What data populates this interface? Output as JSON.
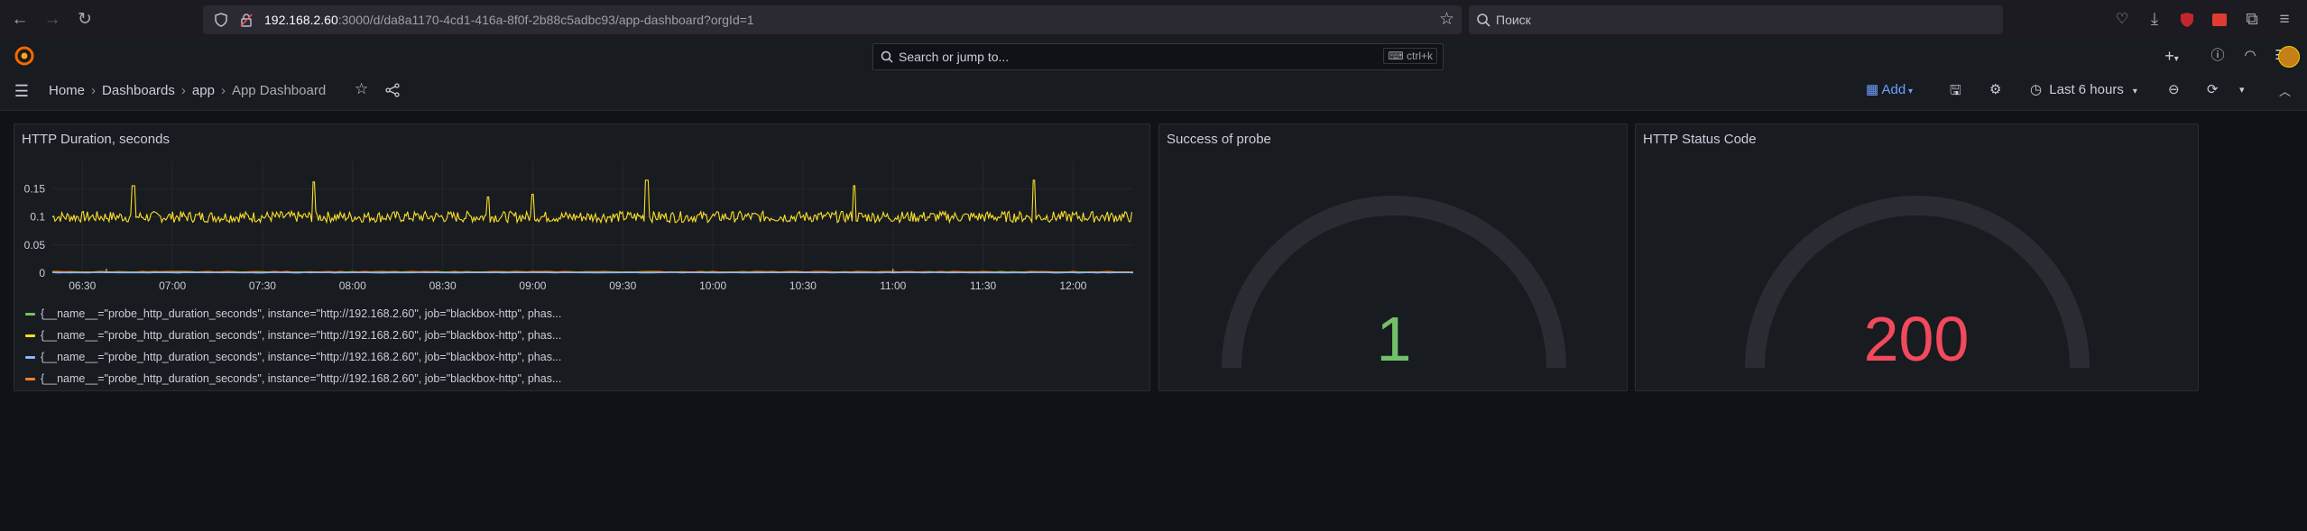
{
  "browser": {
    "url_host": "192.168.2.60",
    "url_rest": ":3000/d/da8a1170-4cd1-416a-8f0f-2b88c5adbc93/app-dashboard?orgId=1",
    "search_placeholder": "Поиск"
  },
  "topbar": {
    "search_placeholder": "Search or jump to...",
    "shortcut": "ctrl+k",
    "add_icon": "+"
  },
  "breadcrumb": {
    "items": [
      "Home",
      "Dashboards",
      "app",
      "App Dashboard"
    ]
  },
  "toolbar": {
    "add_label": "Add",
    "time_range": "Last 6 hours"
  },
  "panels": {
    "duration": {
      "title": "HTTP Duration, seconds",
      "legend": [
        {
          "color": "#73bf69",
          "label": "{__name__=\"probe_http_duration_seconds\", instance=\"http://192.168.2.60\", job=\"blackbox-http\", phas..."
        },
        {
          "color": "#fade2a",
          "label": "{__name__=\"probe_http_duration_seconds\", instance=\"http://192.168.2.60\", job=\"blackbox-http\", phas..."
        },
        {
          "color": "#8ab8ff",
          "label": "{__name__=\"probe_http_duration_seconds\", instance=\"http://192.168.2.60\", job=\"blackbox-http\", phas..."
        },
        {
          "color": "#ff7f24",
          "label": "{__name__=\"probe_http_duration_seconds\", instance=\"http://192.168.2.60\", job=\"blackbox-http\", phas..."
        }
      ]
    },
    "success": {
      "title": "Success of probe",
      "value": "1",
      "color": "#73bf69"
    },
    "status": {
      "title": "HTTP Status Code",
      "value": "200",
      "color": "#f2495c"
    }
  },
  "chart_data": {
    "type": "line",
    "title": "HTTP Duration, seconds",
    "x_ticks": [
      "06:30",
      "07:00",
      "07:30",
      "08:00",
      "08:30",
      "09:00",
      "09:30",
      "10:00",
      "10:30",
      "11:00",
      "11:30",
      "12:00"
    ],
    "y_ticks": [
      "0",
      "0.05",
      "0.1",
      "0.15"
    ],
    "ylim": [
      0,
      0.2
    ],
    "grid": true,
    "legend": "bottom",
    "series": [
      {
        "color": "#fade2a",
        "baseline": 0.1,
        "noise": 0.01,
        "spike_times": [
          "06:47",
          "07:47",
          "08:45",
          "09:00",
          "09:38",
          "10:47",
          "11:47"
        ],
        "spike_values": [
          0.155,
          0.162,
          0.135,
          0.14,
          0.165,
          0.155,
          0.165
        ]
      },
      {
        "color": "#ff7f24",
        "baseline": 0.002
      },
      {
        "color": "#73bf69",
        "baseline": 0.001
      },
      {
        "color": "#8ab8ff",
        "baseline": 0.0005
      }
    ]
  }
}
